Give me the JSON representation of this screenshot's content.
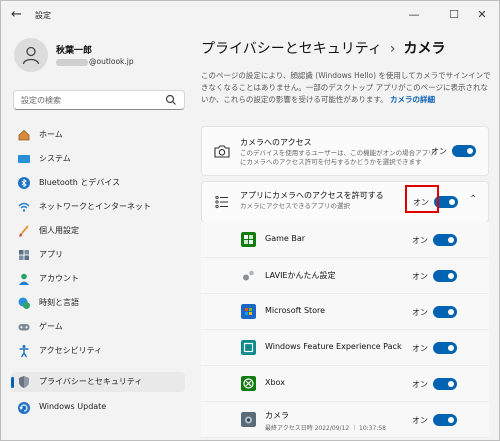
{
  "window": {
    "title": "設定"
  },
  "user": {
    "name": "秋葉一郎",
    "email_suffix": "@outlook.jp"
  },
  "search": {
    "placeholder": "設定の検索"
  },
  "nav": [
    {
      "label": "ホーム",
      "icon": "home-icon"
    },
    {
      "label": "システム",
      "icon": "system-icon"
    },
    {
      "label": "Bluetooth とデバイス",
      "icon": "bluetooth-icon"
    },
    {
      "label": "ネットワークとインターネット",
      "icon": "wifi-icon"
    },
    {
      "label": "個人用設定",
      "icon": "brush-icon"
    },
    {
      "label": "アプリ",
      "icon": "apps-icon"
    },
    {
      "label": "アカウント",
      "icon": "account-icon"
    },
    {
      "label": "時刻と言語",
      "icon": "time-language-icon"
    },
    {
      "label": "ゲーム",
      "icon": "gamepad-icon"
    },
    {
      "label": "アクセシビリティ",
      "icon": "accessibility-icon"
    },
    {
      "label": "プライバシーとセキュリティ",
      "icon": "shield-icon",
      "active": true
    },
    {
      "label": "Windows Update",
      "icon": "update-icon"
    }
  ],
  "breadcrumb": {
    "parent": "プライバシーとセキュリティ",
    "separator": "›",
    "current": "カメラ"
  },
  "description": {
    "text": "このページの設定により、顔認識 (Windows Hello) を使用してカメラでサインインできなくなることはありません。一部のデスクトップ アプリがこのページに表示されないか、これらの設定の影響を受ける可能性があります。",
    "link": "カメラの詳細"
  },
  "camera_access": {
    "title": "カメラへのアクセス",
    "subtitle_line1": "このデバイスを使用するユーザーは、この機能がオンの場合アプリ",
    "subtitle_line2": "にカメラへのアクセス許可を付与するかどうかを選択できます",
    "state_label": "オン",
    "on": true
  },
  "app_access": {
    "title": "アプリにカメラへのアクセスを許可する",
    "subtitle": "カメラにアクセスできるアプリの選択",
    "state_label": "オン",
    "on": true
  },
  "apps": [
    {
      "name": "Game Bar",
      "state_label": "オン",
      "on": true,
      "icon": "game-bar-icon"
    },
    {
      "name": "LAVIEかんたん設定",
      "state_label": "オン",
      "on": true,
      "icon": "lavie-settings-icon"
    },
    {
      "name": "Microsoft Store",
      "state_label": "オン",
      "on": true,
      "icon": "microsoft-store-icon"
    },
    {
      "name": "Windows Feature Experience Pack",
      "state_label": "オン",
      "on": true,
      "icon": "feature-pack-icon"
    },
    {
      "name": "Xbox",
      "state_label": "オン",
      "on": true,
      "icon": "xbox-icon"
    },
    {
      "name": "カメラ",
      "subtitle": "最終アクセス日時 2022/09/12 ｜ 10:37:58",
      "state_label": "オン",
      "on": true,
      "icon": "camera-app-icon"
    }
  ],
  "colors": {
    "accent": "#0063b1",
    "highlight": "#e00000"
  }
}
